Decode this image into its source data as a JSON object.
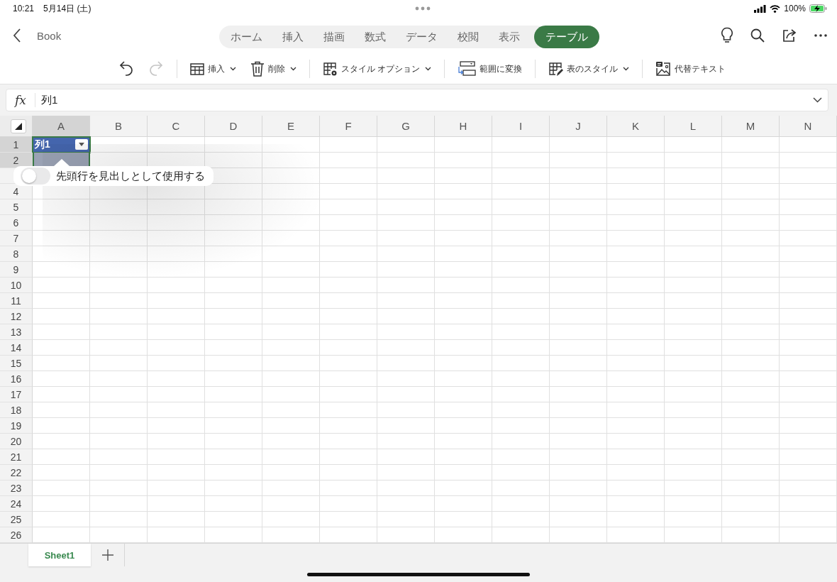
{
  "status_bar": {
    "time": "10:21",
    "date": "5月14日 (土)",
    "battery": "100%"
  },
  "title_bar": {
    "back_label": "Book"
  },
  "ribbon_tabs": [
    {
      "label": "ホーム",
      "selected": false
    },
    {
      "label": "挿入",
      "selected": false
    },
    {
      "label": "描画",
      "selected": false
    },
    {
      "label": "数式",
      "selected": false
    },
    {
      "label": "データ",
      "selected": false
    },
    {
      "label": "校閲",
      "selected": false
    },
    {
      "label": "表示",
      "selected": false
    },
    {
      "label": "テーブル",
      "selected": true
    }
  ],
  "toolbar": [
    {
      "kind": "undo",
      "disabled": false
    },
    {
      "kind": "redo",
      "disabled": true
    },
    {
      "kind": "insert",
      "label": "挿入",
      "dropdown": true,
      "disabled": false
    },
    {
      "kind": "delete",
      "label": "削除",
      "dropdown": true,
      "disabled": false
    },
    {
      "kind": "style-options",
      "label": "スタイル オプション",
      "dropdown": true,
      "disabled": false
    },
    {
      "kind": "convert",
      "label": "範囲に変換",
      "dropdown": false,
      "disabled": false
    },
    {
      "kind": "table-style",
      "label": "表のスタイル",
      "dropdown": true,
      "disabled": false
    },
    {
      "kind": "alt-text",
      "label": "代替テキスト",
      "dropdown": false,
      "disabled": false
    }
  ],
  "formula_bar": {
    "label": "fx",
    "value": "列1"
  },
  "grid": {
    "columns": [
      {
        "label": "A",
        "selected": true
      },
      {
        "label": "B",
        "selected": false
      },
      {
        "label": "C",
        "selected": false
      },
      {
        "label": "D",
        "selected": false
      },
      {
        "label": "E",
        "selected": false
      },
      {
        "label": "F",
        "selected": false
      },
      {
        "label": "G",
        "selected": false
      },
      {
        "label": "H",
        "selected": false
      },
      {
        "label": "I",
        "selected": false
      },
      {
        "label": "J",
        "selected": false
      },
      {
        "label": "K",
        "selected": false
      },
      {
        "label": "L",
        "selected": false
      },
      {
        "label": "M",
        "selected": false
      },
      {
        "label": "N",
        "selected": false
      }
    ],
    "rows": [
      {
        "label": "1",
        "selected": true
      },
      {
        "label": "2",
        "selected": true
      },
      {
        "selected": false
      },
      {
        "label": "4",
        "selected": false
      },
      {
        "label": "5",
        "selected": false
      },
      {
        "label": "6",
        "selected": false
      },
      {
        "label": "7",
        "selected": false
      },
      {
        "label": "8",
        "selected": false
      },
      {
        "label": "9",
        "selected": false
      },
      {
        "label": "10",
        "selected": false
      },
      {
        "label": "11",
        "selected": false
      },
      {
        "label": "12",
        "selected": false
      },
      {
        "label": "13",
        "selected": false
      },
      {
        "label": "14",
        "selected": false
      },
      {
        "label": "15",
        "selected": false
      },
      {
        "label": "16",
        "selected": false
      },
      {
        "label": "17",
        "selected": false
      },
      {
        "label": "18",
        "selected": false
      },
      {
        "label": "19",
        "selected": false
      },
      {
        "label": "20",
        "selected": false
      },
      {
        "label": "21",
        "selected": false
      },
      {
        "label": "22",
        "selected": false
      },
      {
        "label": "23",
        "selected": false
      },
      {
        "label": "24",
        "selected": false
      },
      {
        "label": "25",
        "selected": false
      },
      {
        "label": "26",
        "selected": false
      }
    ],
    "table_header": "列1"
  },
  "popover": {
    "label": "先頭行を見出しとして使用する",
    "on": false
  },
  "sheet_tabs": [
    {
      "label": "Sheet1",
      "selected": true
    }
  ]
}
